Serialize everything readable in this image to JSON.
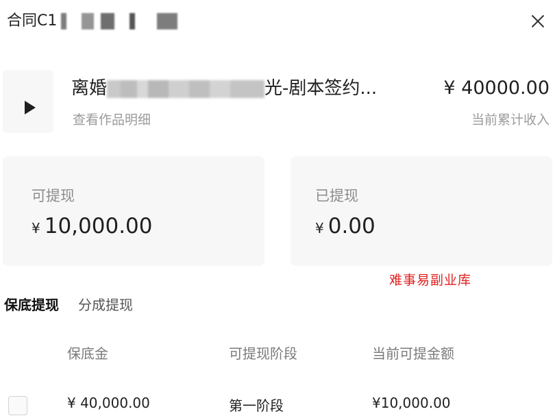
{
  "header": {
    "title": "合同C1"
  },
  "work": {
    "title_prefix": "离婚",
    "title_suffix": "光-剧本签约...",
    "detail_link": "查看作品明细",
    "earnings_amount": "¥ 40000.00",
    "earnings_label": "当前累计收入"
  },
  "cards": {
    "withdrawable": {
      "label": "可提现",
      "currency": "¥",
      "value": "10,000.00"
    },
    "withdrawn": {
      "label": "已提现",
      "currency": "¥",
      "value": "0.00"
    }
  },
  "watermark": {
    "text": "难事易副业库"
  },
  "tabs": [
    {
      "label": "保底提现",
      "active": true
    },
    {
      "label": "分成提现",
      "active": false
    }
  ],
  "table": {
    "columns": [
      "保底金",
      "可提现阶段",
      "当前可提金额"
    ],
    "rows": [
      {
        "base_amount": "¥ 40,000.00",
        "stage": "第一阶段",
        "available": "¥10,000.00"
      }
    ]
  }
}
